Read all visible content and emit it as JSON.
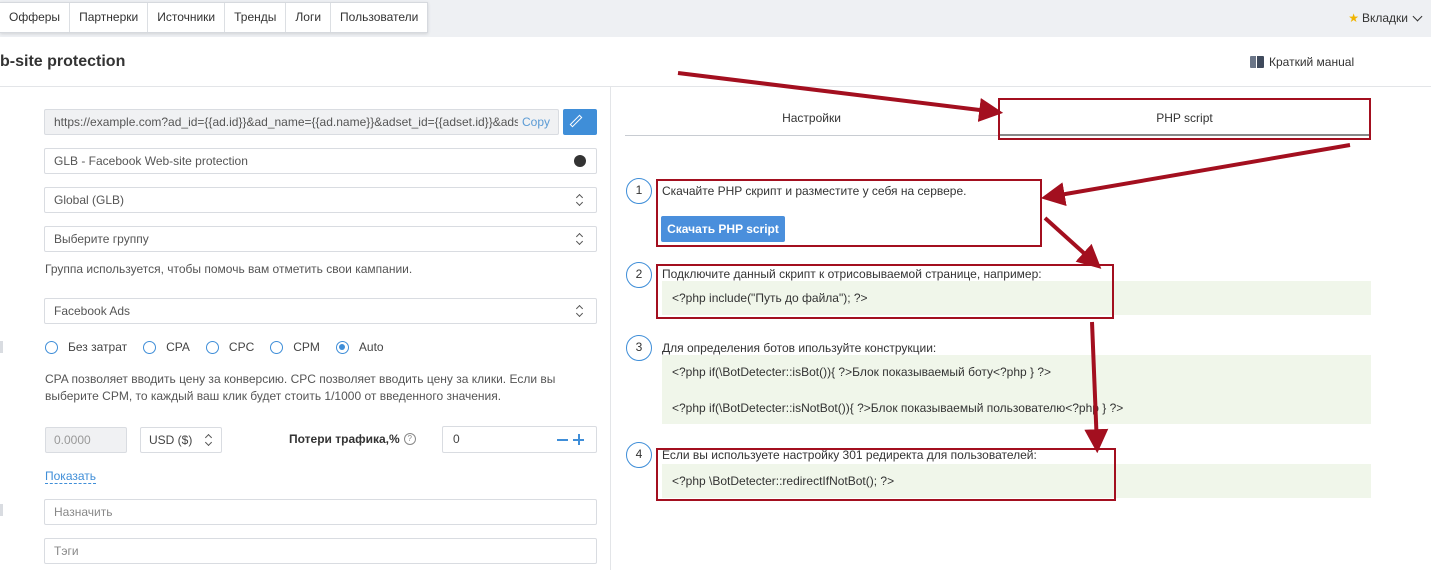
{
  "nav": {
    "tabs": [
      "Офферы",
      "Партнерки",
      "Источники",
      "Тренды",
      "Логи",
      "Пользователи"
    ],
    "tabs_menu": "Вкладки"
  },
  "header": {
    "title": "b-site protection",
    "manual_link": "Краткий манual"
  },
  "form": {
    "url_value": "https://example.com?ad_id={{ad.id}}&ad_name={{ad.name}}&adset_id={{adset.id}}&ads",
    "copy_label": "Copy",
    "name_value": "GLB - Facebook Web-site protection",
    "country_select": "Global (GLB)",
    "group_select": "Выберите группу",
    "group_hint": "Группа используется, чтобы помочь вам отметить свои кампании.",
    "traffic_source": "Facebook Ads",
    "cost_models": [
      {
        "label": "Без затрат",
        "selected": false
      },
      {
        "label": "CPA",
        "selected": false
      },
      {
        "label": "CPC",
        "selected": false
      },
      {
        "label": "CPM",
        "selected": false
      },
      {
        "label": "Auto",
        "selected": true
      }
    ],
    "cost_hint_line1": "CPA позволяет вводить цену за конверсию. CPC позволяет вводить цену за клики. Если вы",
    "cost_hint_line2": "выберите CPM, то каждый ваш клик будет стоить 1/1000 от введенного значения.",
    "cost_value": "0.0000",
    "currency": "USD ($)",
    "traffic_loss_label": "Потери трафика,%",
    "traffic_loss_value": "0",
    "show_link": "Показать",
    "assign_placeholder": "Назначить",
    "tags_placeholder": "Тэги"
  },
  "right": {
    "tab_settings": "Настройки",
    "tab_php": "PHP script",
    "steps": [
      {
        "num": "1",
        "text": "Скачайте PHP скрипт и разместите у себя на сервере.",
        "button": "Скачать PHP script"
      },
      {
        "num": "2",
        "text": "Подключите данный скрипт к отрисовываемой странице, например:",
        "code": [
          "<?php include(\"Путь до файла\"); ?>"
        ]
      },
      {
        "num": "3",
        "text": "Для определения ботов ипользуйте конструкции:",
        "code": [
          "<?php if(\\BotDetecter::isBot()){ ?>Блок показываемый боту<?php } ?>",
          "<?php if(\\BotDetecter::isNotBot()){ ?>Блок показываемый пользователю<?php } ?>"
        ]
      },
      {
        "num": "4",
        "text": "Если вы используете настройку 301 редиректа для пользователей:",
        "code": [
          "<?php \\BotDetecter::redirectIfNotBot(); ?>"
        ]
      }
    ]
  },
  "colors": {
    "accent": "#3f8ed8",
    "annotation": "#a30f1f",
    "code_bg": "#f0f6ea"
  }
}
